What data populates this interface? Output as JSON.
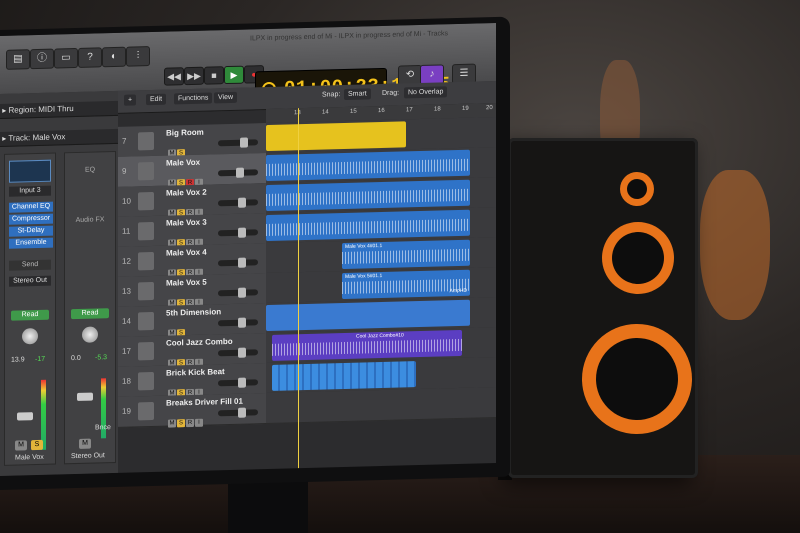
{
  "window": {
    "title": "ILPX in progress end of Mi - ILPX in progress end of Mi - Tracks"
  },
  "lcd": {
    "time": "01:00:23:18.15"
  },
  "inspector": {
    "region_label": "Region: MIDI Thru",
    "track_label": "Track: Male Vox",
    "input": "Input 3",
    "eq_label": "EQ",
    "audio_fx": "Audio FX",
    "plugins": [
      "Channel EQ",
      "Compressor",
      "St-Delay",
      "Ensemble"
    ],
    "send": "Send",
    "output": "Stereo Out",
    "read_left": "Read",
    "read_right": "Read",
    "vol_left": "13.9",
    "peak_left": "-17",
    "vol_right": "0.0",
    "peak_right": "-5.3",
    "bounce": "Bnce",
    "name_left": "Male Vox",
    "name_right": "Stereo Out"
  },
  "tracks_header": {
    "edit": "Edit",
    "functions": "Functions",
    "view": "View",
    "snap_label": "Snap:",
    "snap_value": "Smart",
    "drag_label": "Drag:",
    "drag_value": "No Overlap"
  },
  "ruler": {
    "bars": [
      "13",
      "14",
      "15",
      "16",
      "17",
      "18",
      "19",
      "20"
    ]
  },
  "tracks": [
    {
      "num": "7",
      "name": "Big Room"
    },
    {
      "num": "9",
      "name": "Male Vox"
    },
    {
      "num": "10",
      "name": "Male Vox 2"
    },
    {
      "num": "11",
      "name": "Male Vox 3"
    },
    {
      "num": "12",
      "name": "Male Vox 4"
    },
    {
      "num": "13",
      "name": "Male Vox 5"
    },
    {
      "num": "14",
      "name": "5th Dimension"
    },
    {
      "num": "17",
      "name": "Cool Jazz Combo"
    },
    {
      "num": "18",
      "name": "Brick Kick Beat"
    },
    {
      "num": "19",
      "name": "Breaks Driver Fill 01"
    }
  ],
  "regions": {
    "vox4": "Male Vox 4#01.1",
    "vox5": "Male Vox 5#01.1",
    "amp": "AmpHD",
    "jazz": "Cool Jazz Combo#10"
  },
  "colors": {
    "lcd": "#f4c21a",
    "region_blue": "#2f73c8",
    "region_yellow": "#e6c21e",
    "region_purple": "#5b3ec2",
    "speaker_orange": "#e8731a"
  }
}
